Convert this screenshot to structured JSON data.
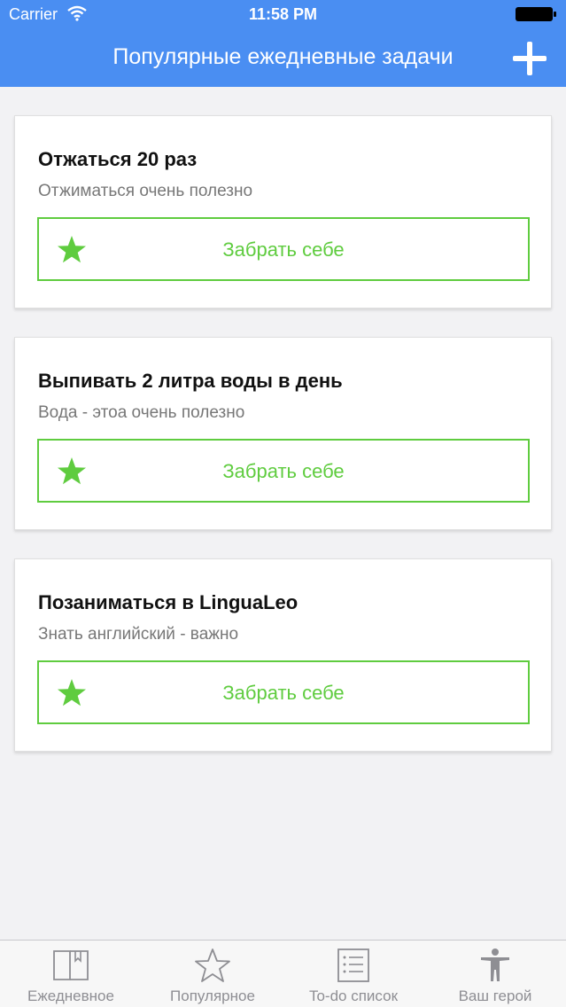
{
  "status_bar": {
    "carrier": "Carrier",
    "time": "11:58 PM"
  },
  "nav": {
    "title": "Популярные ежедневные задачи",
    "add_icon": "plus-icon"
  },
  "cards": [
    {
      "title": "Отжаться 20 раз",
      "description": "Отжиматься очень полезно",
      "button_label": "Забрать себе"
    },
    {
      "title": "Выпивать 2 литра воды в день",
      "description": "Вода - этоа очень полезно",
      "button_label": "Забрать себе"
    },
    {
      "title": "Позаниматься в LinguaLeo",
      "description": "Знать английский - важно",
      "button_label": "Забрать себе"
    }
  ],
  "tabs": [
    {
      "label": "Ежедневное",
      "icon": "book-icon"
    },
    {
      "label": "Популярное",
      "icon": "star-icon"
    },
    {
      "label": "To-do список",
      "icon": "list-icon"
    },
    {
      "label": "Ваш герой",
      "icon": "person-icon"
    }
  ],
  "colors": {
    "header": "#4a8ef2",
    "accent_green": "#5fcc3f",
    "background": "#f2f2f4"
  }
}
